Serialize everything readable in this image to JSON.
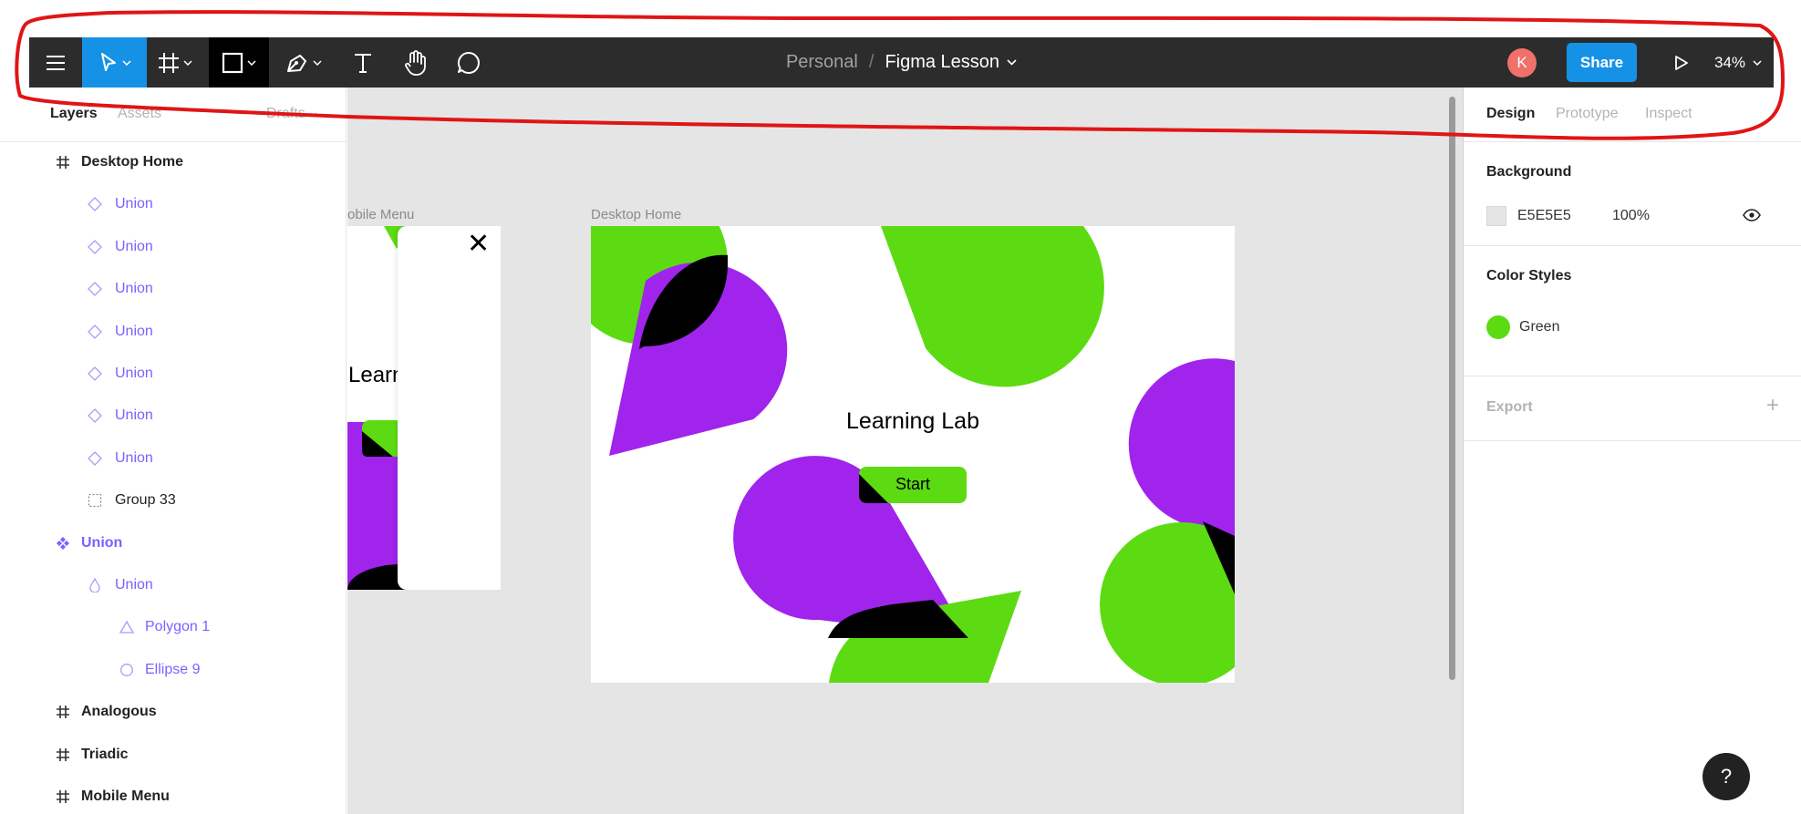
{
  "colors": {
    "toolbar_bg": "#2c2c2c",
    "accent_blue": "#1592e6",
    "green": "#5cdb12",
    "purple": "#a024ec",
    "layer_purple": "#7b61ff",
    "avatar": "#f0706a",
    "annotation_red": "#e01515"
  },
  "toolbar": {
    "menu_icon": "hamburger-icon",
    "tools": [
      "move-tool-icon",
      "frame-tool-icon",
      "rectangle-tool-icon",
      "pen-tool-icon",
      "text-tool-icon",
      "hand-tool-icon",
      "comment-tool-icon"
    ],
    "breadcrumb_team": "Personal",
    "breadcrumb_sep": "/",
    "file_name": "Figma Lesson",
    "avatar_initial": "K",
    "share_label": "Share",
    "zoom": "34%"
  },
  "left_panel": {
    "tabs": {
      "layers": "Layers",
      "assets": "Assets",
      "pages": "Drafts"
    },
    "layers": [
      {
        "label": "Desktop Home",
        "icon": "frame-icon",
        "level": 0
      },
      {
        "label": "Union",
        "icon": "union-icon",
        "level": 1
      },
      {
        "label": "Union",
        "icon": "union-icon",
        "level": 1
      },
      {
        "label": "Union",
        "icon": "union-icon",
        "level": 1
      },
      {
        "label": "Union",
        "icon": "union-icon",
        "level": 1
      },
      {
        "label": "Union",
        "icon": "union-icon",
        "level": 1
      },
      {
        "label": "Union",
        "icon": "union-icon",
        "level": 1
      },
      {
        "label": "Union",
        "icon": "union-icon",
        "level": 1
      },
      {
        "label": "Group 33",
        "icon": "group-icon",
        "level": 1
      },
      {
        "label": "Union",
        "icon": "component-icon",
        "level": 0
      },
      {
        "label": "Union",
        "icon": "drop-icon",
        "level": 1
      },
      {
        "label": "Polygon 1",
        "icon": "polygon-icon",
        "level": 2
      },
      {
        "label": "Ellipse 9",
        "icon": "ellipse-icon",
        "level": 2
      },
      {
        "label": "Analogous",
        "icon": "frame-icon",
        "level": 0
      },
      {
        "label": "Triadic",
        "icon": "frame-icon",
        "level": 0
      },
      {
        "label": "Mobile Menu",
        "icon": "frame-icon",
        "level": 0
      }
    ]
  },
  "canvas": {
    "mobile_frame_label": "obile Menu",
    "desktop_frame_label": "Desktop Home",
    "mobile_partial_text": "Learn",
    "close_glyph": "✕",
    "desktop_title": "Learning Lab",
    "desktop_button": "Start"
  },
  "right_panel": {
    "tabs": {
      "design": "Design",
      "prototype": "Prototype",
      "inspect": "Inspect"
    },
    "background": {
      "title": "Background",
      "hex": "E5E5E5",
      "opacity": "100%",
      "swatch": "#e5e5e5"
    },
    "color_styles": {
      "title": "Color Styles",
      "name": "Green",
      "swatch": "#5cdb12"
    },
    "export": {
      "title": "Export",
      "add": "+"
    }
  },
  "help_label": "?"
}
